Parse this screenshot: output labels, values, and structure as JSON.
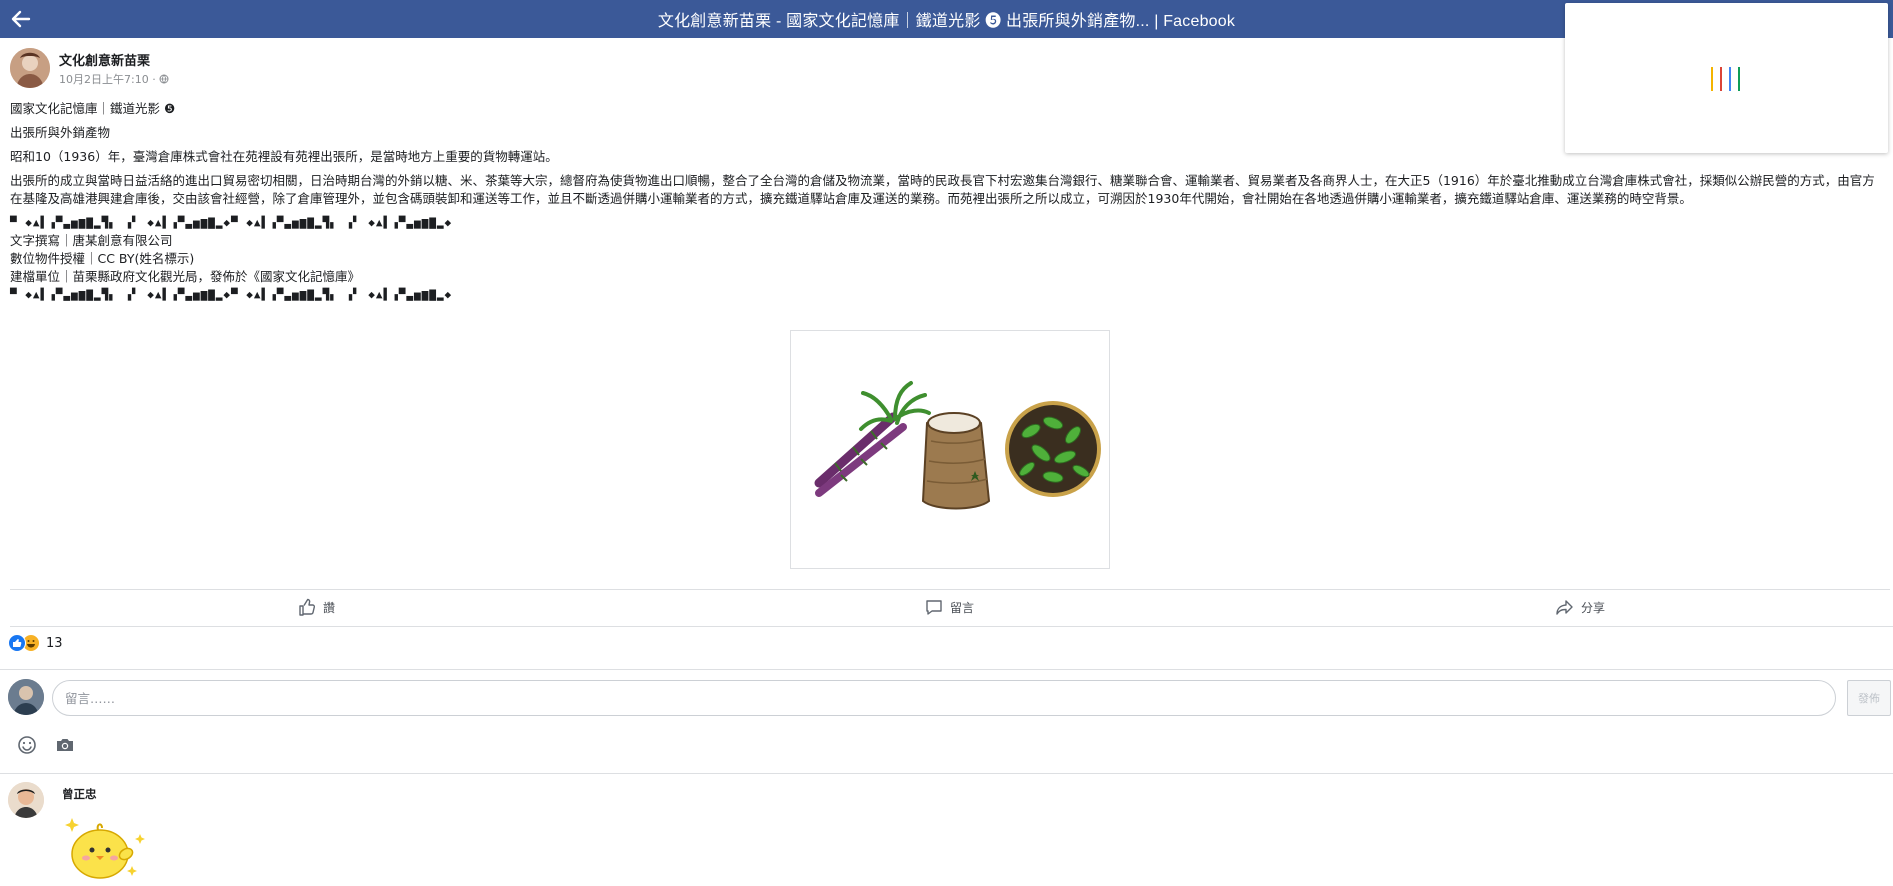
{
  "window": {
    "title": "文化創意新苗栗 - 國家文化記憶庫｜鐵道光影 ❺ 出張所與外銷產物... | Facebook"
  },
  "post": {
    "page_name": "文化創意新苗栗",
    "time": "10月2日上午7:10 ·",
    "paragraphs": [
      "國家文化記憶庫｜鐵道光影 ❺",
      "出張所與外銷產物",
      "昭和10（1936）年，臺灣倉庫株式會社在苑裡設有苑裡出張所，是當時地方上重要的貨物轉運站。",
      "出張所的成立與當時日益活絡的進出口貿易密切相關，日治時期台灣的外銷以糖、米、茶葉等大宗，總督府為使貨物進出口順暢，整合了全台灣的倉儲及物流業，當時的民政長官下村宏邀集台灣銀行、糖業聯合會、運輸業者、貿易業者及各商界人士，在大正5（1916）年於臺北推動成立台灣倉庫株式會社，採類似公辦民營的方式，由官方在基隆及高雄港興建倉庫後，交由該會社經營，除了倉庫管理外，並包含碼頭裝卸和運送等工作，並且不斷透過併購小運輸業者的方式，擴充鐵道驛站倉庫及運送的業務。而苑裡出張所之所以成立，可溯因於1930年代開始，會社開始在各地透過併購小運輸業者，擴充鐵道驛站倉庫、運送業務的時空背景。"
    ],
    "separator": "▀ ◆▲▌▗▀▃▅▆▇▂▜▖ ▗▘ ◆▲▌▗▀▃▅▆▇▂◆▀ ◆▲▌▗▀▃▅▆▇▂▜▖ ▗▘ ◆▲▌▗▀▃▅▆▇▂◆",
    "credits": [
      "文字撰寫｜唐某創意有限公司",
      "數位物件授權｜CC BY(姓名標示)",
      "建檔單位｜苗栗縣政府文化觀光局，發佈於《國家文化記憶庫》"
    ]
  },
  "actions": {
    "like": "讚",
    "comment": "留言",
    "share": "分享"
  },
  "reactions": {
    "count": "13"
  },
  "comment_box": {
    "placeholder": "留言……",
    "submit": "發佈"
  },
  "comments": [
    {
      "author": "曾正忠"
    }
  ],
  "colors": {
    "header": "#3b5998",
    "like": "#1877f2",
    "haha": "#f7b125",
    "loader": [
      "#f4b400",
      "#db4437",
      "#4285f4",
      "#0f9d58"
    ]
  },
  "icons": [
    "back-arrow-icon",
    "globe-icon",
    "thumbs-up-icon",
    "comment-bubble-icon",
    "share-arrow-icon",
    "smiley-icon",
    "camera-icon"
  ]
}
